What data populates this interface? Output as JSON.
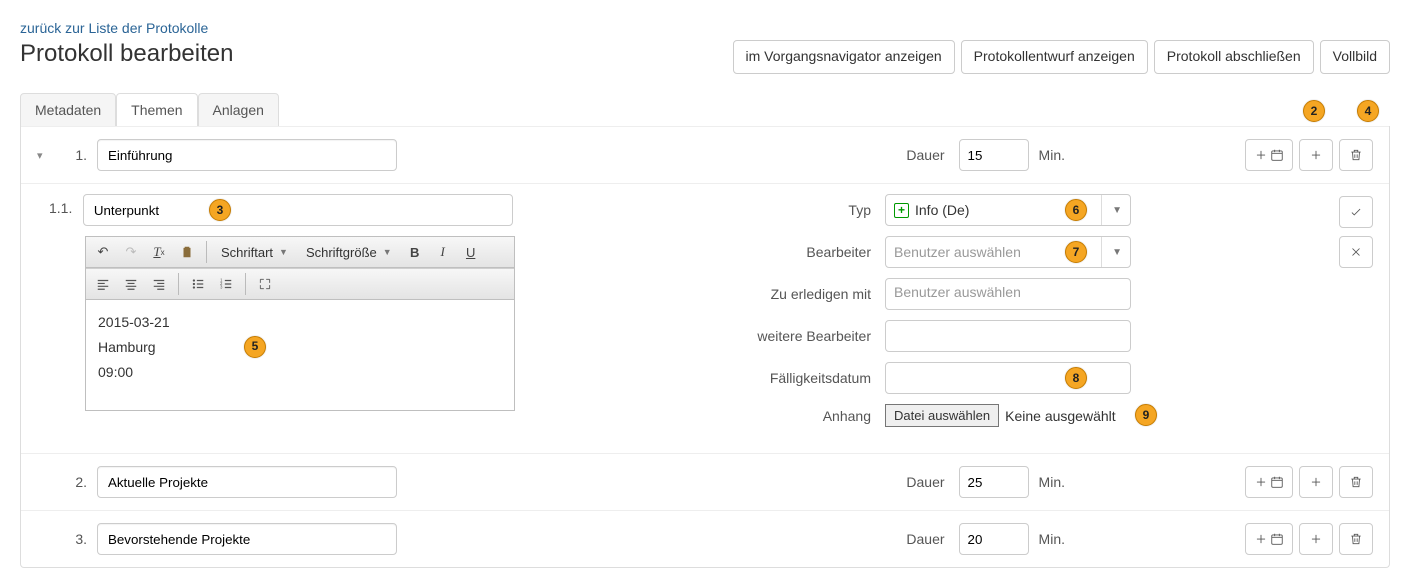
{
  "nav": {
    "back_link": "zurück zur Liste der Protokolle"
  },
  "page": {
    "title": "Protokoll bearbeiten"
  },
  "header_buttons": {
    "show_in_navigator": "im Vorgangsnavigator anzeigen",
    "show_draft": "Protokollentwurf anzeigen",
    "finalize": "Protokoll abschließen",
    "fullscreen": "Vollbild"
  },
  "tabs": {
    "metadata": "Metadaten",
    "topics": "Themen",
    "attachments": "Anlagen"
  },
  "labels": {
    "duration": "Dauer",
    "minutes": "Min.",
    "type": "Typ",
    "assignee": "Bearbeiter",
    "todo_with": "Zu erledigen mit",
    "more_assignees": "weitere Bearbeiter",
    "due_date": "Fälligkeitsdatum",
    "attachment": "Anhang",
    "choose_file": "Datei auswählen",
    "none_chosen": "Keine ausgewählt",
    "select_user": "Benutzer auswählen",
    "font": "Schriftart",
    "fontsize": "Schriftgröße"
  },
  "topics": [
    {
      "num": "1.",
      "title": "Einführung",
      "duration": "15"
    },
    {
      "num": "2.",
      "title": "Aktuelle Projekte",
      "duration": "25"
    },
    {
      "num": "3.",
      "title": "Bevorstehende Projekte",
      "duration": "20"
    }
  ],
  "sub": {
    "num": "1.1.",
    "title": "Unterpunkt",
    "type_value": "Info (De)",
    "body_line1": "2015-03-21",
    "body_line2": "Hamburg",
    "body_line3": "09:00"
  },
  "markers": {
    "m2": "2",
    "m3": "3",
    "m4": "4",
    "m5": "5",
    "m6": "6",
    "m7": "7",
    "m8": "8",
    "m9": "9"
  }
}
